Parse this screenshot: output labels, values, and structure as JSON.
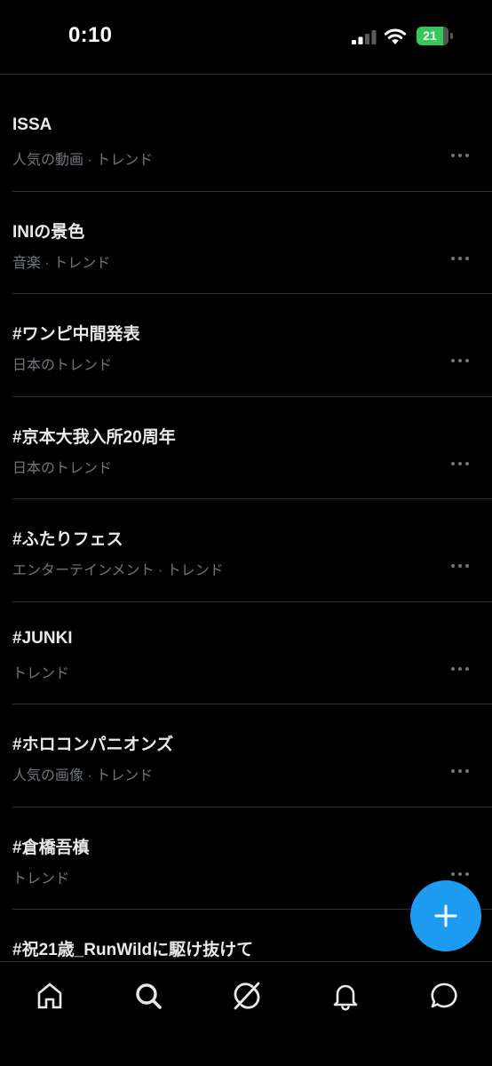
{
  "status_bar": {
    "time": "0:10",
    "battery": "21"
  },
  "trends": [
    {
      "title": "ISSA",
      "meta": "人気の動画 · トレンド"
    },
    {
      "title": "INIの景色",
      "meta": "音楽 · トレンド"
    },
    {
      "title": "#ワンピ中間発表",
      "meta": "日本のトレンド"
    },
    {
      "title": "#京本大我入所20周年",
      "meta": "日本のトレンド"
    },
    {
      "title": "#ふたりフェス",
      "meta": "エンターテインメント · トレンド"
    },
    {
      "title": "#JUNKI",
      "meta": "トレンド"
    },
    {
      "title": "#ホロコンパニオンズ",
      "meta": "人気の画像 · トレンド"
    },
    {
      "title": "#倉橋吾槙",
      "meta": "トレンド"
    },
    {
      "title": "#祝21歳_RunWildに駆け抜けて",
      "meta": ""
    }
  ],
  "icons": {
    "more": "more-dots-icon",
    "fab": "plus-icon",
    "nav": [
      "home-icon",
      "search-icon",
      "grok-icon",
      "bell-icon",
      "messages-icon"
    ]
  },
  "colors": {
    "background": "#000000",
    "primary_text": "#e7e9ea",
    "secondary_text": "#71767b",
    "divider": "#2f3336",
    "accent": "#1d9bf0",
    "battery": "#34c759"
  }
}
